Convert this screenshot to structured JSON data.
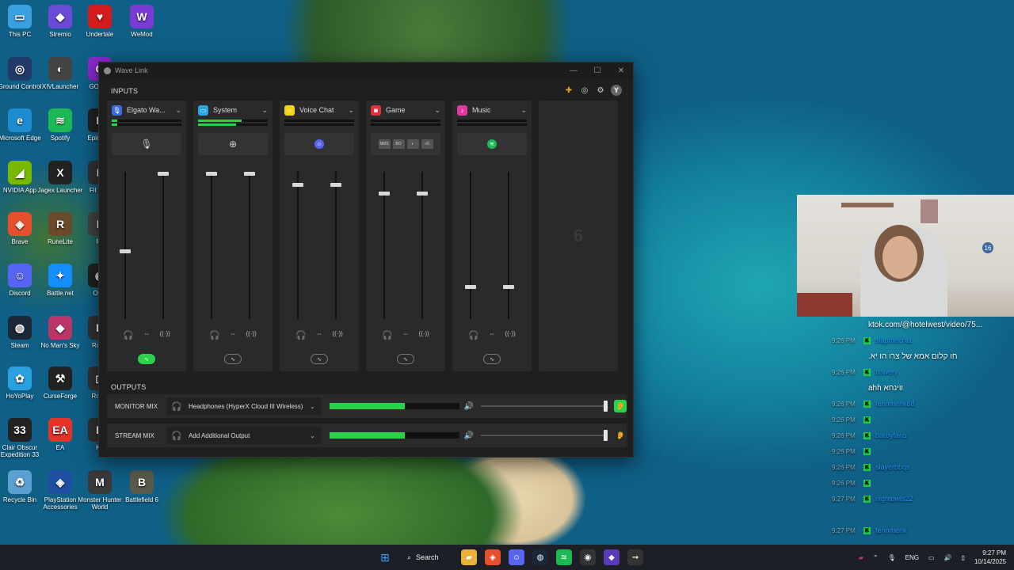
{
  "desktop": {
    "icons": [
      {
        "label": "This PC",
        "glyph": "▭",
        "color": "#3aa0e0"
      },
      {
        "label": "Stremio",
        "glyph": "◆",
        "color": "#6a4ad6"
      },
      {
        "label": "Undertale",
        "glyph": "♥",
        "color": "#d41a1a"
      },
      {
        "label": "WeMod",
        "glyph": "W",
        "color": "#7a3ad6"
      },
      {
        "label": "Ground Control",
        "glyph": "◎",
        "color": "#223a6a"
      },
      {
        "label": "XIVLauncher",
        "glyph": "◐",
        "color": "#444"
      },
      {
        "label": "GOG G",
        "glyph": "G",
        "color": "#8a2ad0"
      },
      {
        "label": "Microsoft Edge",
        "glyph": "e",
        "color": "#1c8bd0"
      },
      {
        "label": "Spotify",
        "glyph": "≋",
        "color": "#1db954"
      },
      {
        "label": "Epic Lau",
        "glyph": "E",
        "color": "#222"
      },
      {
        "label": "NVIDIA App",
        "glyph": "◢",
        "color": "#76b900"
      },
      {
        "label": "Jagex Launcher",
        "glyph": "X",
        "color": "#222"
      },
      {
        "label": "Fil FAN",
        "glyph": "F",
        "color": "#333"
      },
      {
        "label": "Brave",
        "glyph": "◈",
        "color": "#e5502d"
      },
      {
        "label": "RuneLite",
        "glyph": "R",
        "color": "#6a4a2a"
      },
      {
        "label": "Fo",
        "glyph": "F",
        "color": "#444"
      },
      {
        "label": "Discord",
        "glyph": "☺",
        "color": "#5865f2"
      },
      {
        "label": "Battle.net",
        "glyph": "✦",
        "color": "#148eff"
      },
      {
        "label": "OBS",
        "glyph": "◉",
        "color": "#222"
      },
      {
        "label": "Steam",
        "glyph": "◍",
        "color": "#1b2838"
      },
      {
        "label": "No Man's Sky",
        "glyph": "◆",
        "color": "#b8366a"
      },
      {
        "label": "Ro St",
        "glyph": "R",
        "color": "#333"
      },
      {
        "label": "HoYoPlay",
        "glyph": "✿",
        "color": "#2aa0e0"
      },
      {
        "label": "CurseForge",
        "glyph": "⚒",
        "color": "#222"
      },
      {
        "label": "Roblo",
        "glyph": "◻",
        "color": "#333"
      },
      {
        "label": "Clair Obscur Expedition 33",
        "glyph": "33",
        "color": "#222"
      },
      {
        "label": "EA",
        "glyph": "EA",
        "color": "#e5332a"
      },
      {
        "label": "Kn",
        "glyph": "K",
        "color": "#333"
      },
      {
        "label": "Recycle Bin",
        "glyph": "♻",
        "color": "#5aa0d0"
      },
      {
        "label": "PlayStation Accessories",
        "glyph": "◈",
        "color": "#1e4fa0"
      },
      {
        "label": "Monster Hunter World",
        "glyph": "M",
        "color": "#3a3a3a"
      },
      {
        "label": "Battlefield 6",
        "glyph": "B",
        "color": "#5a5a4a"
      }
    ]
  },
  "window": {
    "title": "Wave Link",
    "controls": {
      "minimize": "—",
      "maximize": "☐",
      "close": "✕"
    }
  },
  "inputs_label": "INPUTS",
  "toolbar": {
    "mixer_icon": "✚",
    "headset_icon": "◎",
    "settings_icon": "⚙",
    "avatar_letter": "Y"
  },
  "channels": [
    {
      "name": "Elgato Wa...",
      "icon_color": "#3b6be0",
      "icon_glyph": "🎙",
      "meter": [
        0.08,
        0.08
      ],
      "app_glyph": "🎙",
      "app_color": "transparent",
      "fader_left": 0.46,
      "fader_right": 1.0,
      "mix_on": true
    },
    {
      "name": "System",
      "icon_color": "#2aa6e0",
      "icon_glyph": "▭",
      "meter": [
        0.62,
        0.55
      ],
      "app_glyph": "⊕",
      "app_color": "transparent",
      "fader_left": 1.0,
      "fader_right": 1.0,
      "mix_on": false
    },
    {
      "name": "Voice Chat",
      "icon_color": "#f2d51a",
      "icon_glyph": "○",
      "meter": [
        0.0,
        0.0
      ],
      "app_glyph": "☺",
      "app_color": "#5865f2",
      "fader_left": 0.92,
      "fader_right": 0.92,
      "mix_on": false
    },
    {
      "name": "Game",
      "icon_color": "#e0313f",
      "icon_glyph": "◙",
      "meter": [
        0.0,
        0.0
      ],
      "apps": [
        "NMS",
        "BO",
        "◐"
      ],
      "more": "+5",
      "fader_left": 0.86,
      "fader_right": 0.86,
      "mix_on": false
    },
    {
      "name": "Music",
      "icon_color": "#e03aa0",
      "icon_glyph": "♪",
      "meter": [
        0.0,
        0.0
      ],
      "app_glyph": "≋",
      "app_color": "#1db954",
      "fader_left": 0.21,
      "fader_right": 0.21,
      "mix_on": false
    }
  ],
  "empty_slot_label": "6",
  "channel_controls": {
    "headphone_icon": "🎧",
    "link_icon": "⇔",
    "stream_icon": "((·))",
    "mix_icon": "∿"
  },
  "outputs_label": "OUTPUTS",
  "outputs": [
    {
      "name": "MONITOR MIX",
      "device": "Headphones (HyperX Cloud III Wireless)",
      "level": 0.58,
      "volume": 1.0,
      "ear_on": true
    },
    {
      "name": "STREAM MIX",
      "device": "Add Additional Output",
      "level": 0.58,
      "volume": 1.0,
      "ear_on": false
    }
  ],
  "output_icons": {
    "headphone": "🎧",
    "speaker": "🔊",
    "ear": "👂"
  },
  "webcam_badge": "16",
  "chat": [
    {
      "time": "",
      "user": "",
      "text": "ktok.com/@hotelwest/video/75..."
    },
    {
      "time": "9:26 PM",
      "user": "slapthechat",
      "text": ""
    },
    {
      "time": "",
      "user": "",
      "text": ".חו קלום אמא של צרו הו יא"
    },
    {
      "time": "9:26 PM",
      "user": "flowery",
      "text": ""
    },
    {
      "time": "",
      "user": "",
      "text": "ahh ווינחא"
    },
    {
      "time": "9:26 PM",
      "user": "fenomenk88",
      "text": ""
    },
    {
      "time": "9:26 PM",
      "user": "",
      "text": ""
    },
    {
      "time": "9:26 PM",
      "user": "barbyfans",
      "text": ""
    },
    {
      "time": "9:26 PM",
      "user": "",
      "text": ""
    },
    {
      "time": "9:26 PM",
      "user": "slayerbbqs",
      "text": ""
    },
    {
      "time": "9:26 PM",
      "user": "",
      "text": ""
    },
    {
      "time": "9:27 PM",
      "user": "nightowls22",
      "text": ""
    },
    {
      "time": "",
      "user": "",
      "text": ""
    },
    {
      "time": "9:27 PM",
      "user": "fenomenk",
      "text": ""
    }
  ],
  "taskbar": {
    "search_label": "Search",
    "apps": [
      {
        "name": "file-explorer",
        "glyph": "▰",
        "color": "#e8b13a"
      },
      {
        "name": "brave",
        "glyph": "◈",
        "color": "#e5502d"
      },
      {
        "name": "discord",
        "glyph": "☺",
        "color": "#5865f2"
      },
      {
        "name": "steam",
        "glyph": "◍",
        "color": "#1b2838"
      },
      {
        "name": "spotify",
        "glyph": "≋",
        "color": "#1db954"
      },
      {
        "name": "obs",
        "glyph": "◉",
        "color": "#333"
      },
      {
        "name": "stremio",
        "glyph": "◆",
        "color": "#5a3ab6"
      },
      {
        "name": "wave-link",
        "glyph": "⇝",
        "color": "#333"
      }
    ],
    "tray_app": "▰",
    "language": "ENG",
    "time": "9:27 PM",
    "date": "10/14/2025"
  }
}
